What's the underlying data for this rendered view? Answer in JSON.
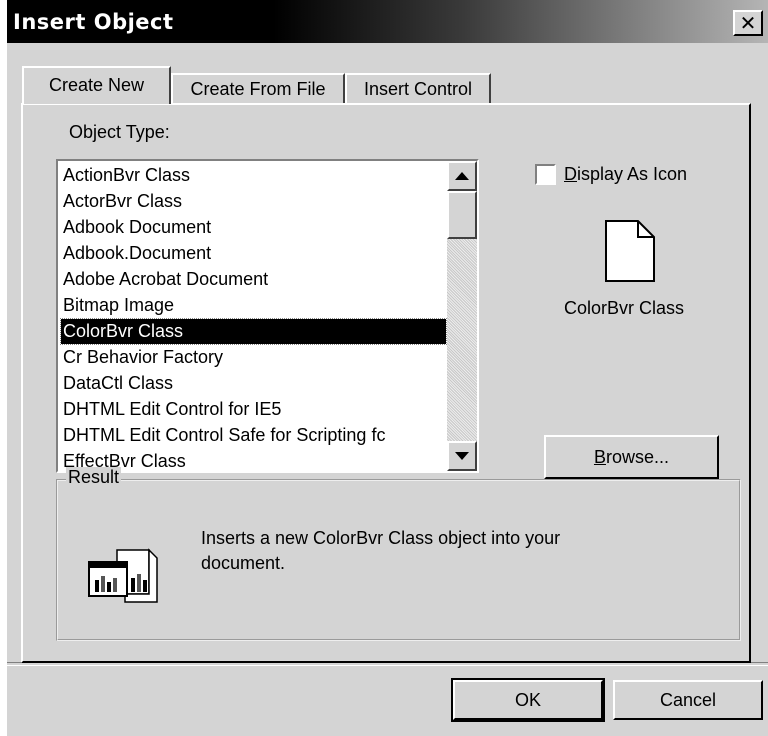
{
  "window": {
    "title": "Insert Object",
    "close_symbol": "✕"
  },
  "tabs": [
    {
      "label": "Create New",
      "active": true
    },
    {
      "label": "Create From File",
      "active": false
    },
    {
      "label": "Insert Control",
      "active": false
    }
  ],
  "object_type": {
    "label": "Object Type:",
    "items": [
      "ActionBvr Class",
      "ActorBvr Class",
      "Adbook Document",
      "Adbook.Document",
      "Adobe Acrobat Document",
      "Bitmap Image",
      "ColorBvr Class",
      "Cr Behavior Factory",
      "DataCtl Class",
      "DHTML Edit Control for IE5",
      "DHTML Edit Control Safe for Scripting fc",
      "EffectBvr Class"
    ],
    "selected_index": 6
  },
  "display_as_icon": {
    "label": "Display As Icon",
    "checked": false
  },
  "icon_caption": "ColorBvr Class",
  "browse_button": "Browse...",
  "result": {
    "label": "Result",
    "text_line1": "Inserts a new ColorBvr Class object into your",
    "text_line2": "document."
  },
  "ok_button": "OK",
  "cancel_button": "Cancel",
  "colors": {
    "face": "#d4d4d4",
    "titlebar": "#000000",
    "selection": "#000000"
  }
}
